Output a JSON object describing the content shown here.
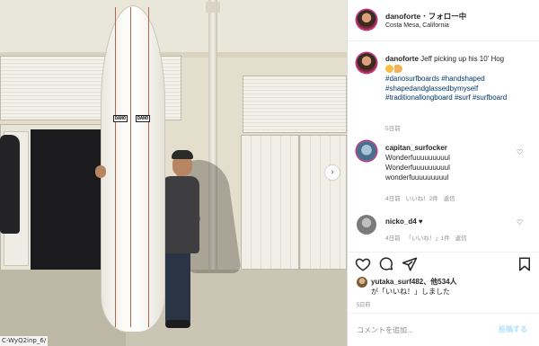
{
  "photo": {
    "board_logo": "DANO",
    "url_label": "C-WyQ2inp_6/"
  },
  "header": {
    "username": "danoforte",
    "separator": "・",
    "follow_label": "フォロー中",
    "location": "Costa Mesa, California"
  },
  "caption": {
    "username": "danoforte",
    "text": "Jeff picking up his 10' Hog",
    "hashtags": "#danosurfboards #handshaped #shapedandglassedbymyself #traditionallongboard #surf #surfboard",
    "time": "5日前"
  },
  "comments": [
    {
      "username": "capitan_surfocker",
      "text": "Wonderfuuuuuuuuul Wonderfuuuuuuuuul wonderfuuuuuuuuul",
      "time": "4日前",
      "likes": "いいね！2件",
      "reply": "返信"
    },
    {
      "username": "nicko_d4",
      "text": "♥",
      "time": "4日前",
      "likes": "「いいね！」1件",
      "reply": "返信"
    }
  ],
  "likes": {
    "users": "yutaka_surf482、他534人",
    "suffix": "が「いいね！」しました"
  },
  "post_time": "5日前",
  "comment_box": {
    "placeholder": "コメントを追加...",
    "post_label": "投稿する"
  },
  "icons": [
    "heart-icon",
    "comment-icon",
    "share-icon",
    "bookmark-icon",
    "chevron-right-icon"
  ],
  "colors": {
    "link": "#00376b",
    "meta": "#8e8e8e",
    "post_button": "#b2dffc",
    "text": "#262626"
  }
}
